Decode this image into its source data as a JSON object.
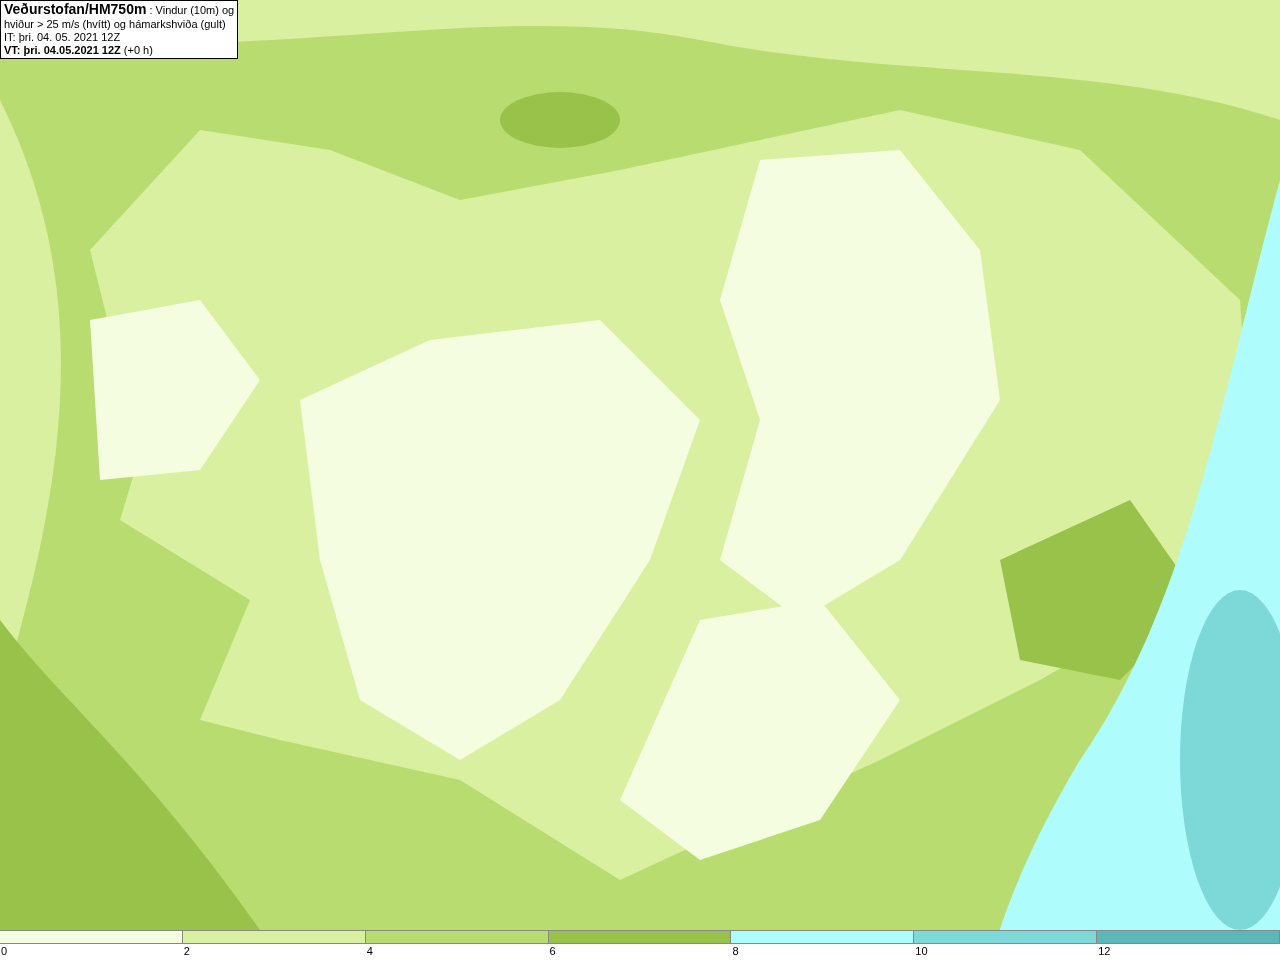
{
  "legend": {
    "lines": [
      "**Veðurstofan/HM750m** : Vindur (10m) og",
      "hviður > 25 m/s (hvítt) og hámarkshviða (gult)",
      "IT: þri. 04. 05. 2021 12Z",
      "**VT: þri. 04.05.2021 12Z** (+0 h)"
    ]
  },
  "colorbar": [
    {
      "label": "0",
      "color": "#f5fde0"
    },
    {
      "label": "2",
      "color": "#d9f0a0"
    },
    {
      "label": "4",
      "color": "#b8dc70"
    },
    {
      "label": "6",
      "color": "#98c24a"
    },
    {
      "label": "8",
      "color": "#aefcfc"
    },
    {
      "label": "10",
      "color": "#7dd8d8"
    },
    {
      "label": "12",
      "color": "#5ab8b8"
    }
  ]
}
